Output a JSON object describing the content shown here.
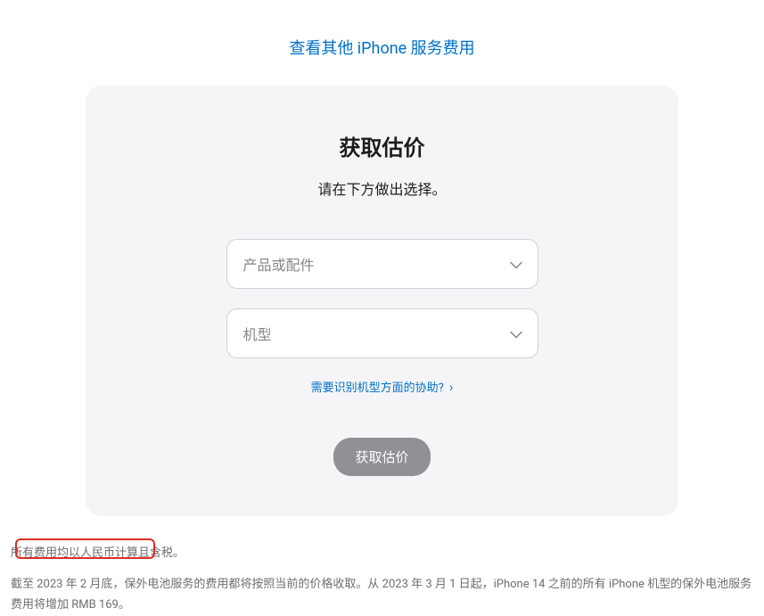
{
  "topLink": {
    "label": "查看其他 iPhone 服务费用"
  },
  "card": {
    "title": "获取估价",
    "subtitle": "请在下方做出选择。",
    "select1": {
      "placeholder": "产品或配件"
    },
    "select2": {
      "placeholder": "机型"
    },
    "helpLink": "需要识别机型方面的协助?",
    "submitLabel": "获取估价"
  },
  "footer": {
    "note": "所有费用均以人民币计算且含税。",
    "text": "截至 2023 年 2 月底，保外电池服务的费用都将按照当前的价格收取。从 2023 年 3 月 1 日起，iPhone 14 之前的所有 iPhone 机型的保外电池服务费用将增加 RMB 169。"
  }
}
